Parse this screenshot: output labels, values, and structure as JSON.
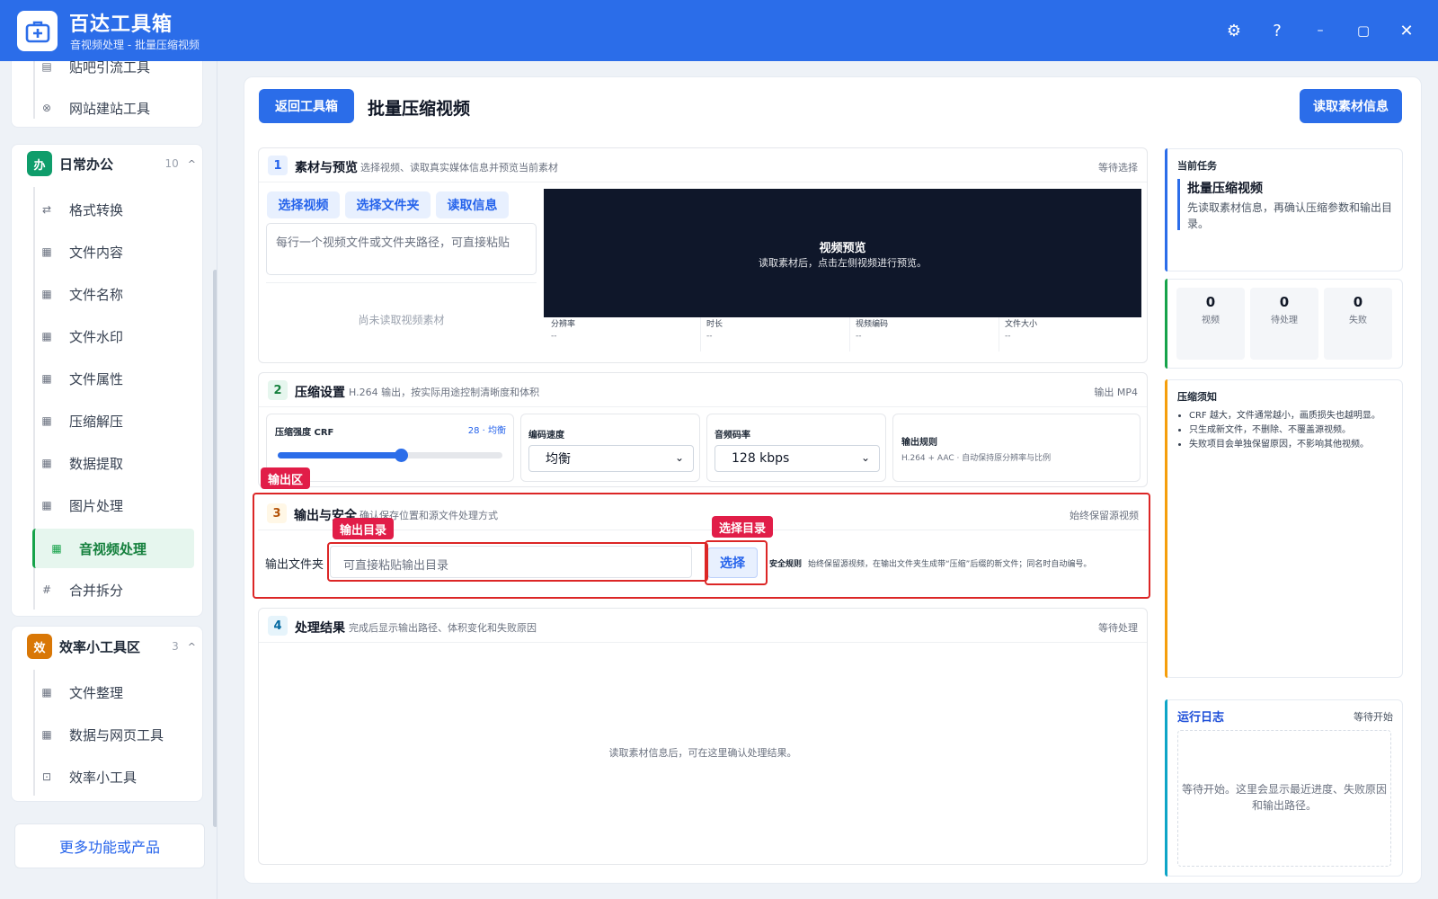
{
  "app": {
    "title": "百达工具箱",
    "subtitle": "音视频处理 - 批量压缩视频"
  },
  "window_controls": {
    "settings": "⚙",
    "help": "?",
    "minimize": "–",
    "maximize": "▢",
    "close": "✕"
  },
  "sidebar": {
    "top_items": [
      {
        "label": "贴吧引流工具",
        "icon": "doc-icon"
      },
      {
        "label": "网站建站工具",
        "icon": "globe-icon"
      }
    ],
    "groups": [
      {
        "title": "日常办公",
        "badge": "办",
        "count": "10",
        "items": [
          {
            "label": "格式转换",
            "icon": "swap-icon"
          },
          {
            "label": "文件内容",
            "icon": "grid-icon"
          },
          {
            "label": "文件名称",
            "icon": "grid-icon"
          },
          {
            "label": "文件水印",
            "icon": "grid-icon"
          },
          {
            "label": "文件属性",
            "icon": "grid-icon"
          },
          {
            "label": "压缩解压",
            "icon": "grid-icon"
          },
          {
            "label": "数据提取",
            "icon": "grid-icon"
          },
          {
            "label": "图片处理",
            "icon": "grid-icon"
          },
          {
            "label": "音视频处理",
            "icon": "grid-icon"
          },
          {
            "label": "合并拆分",
            "icon": "hash-icon"
          }
        ]
      },
      {
        "title": "效率小工具区",
        "badge": "效",
        "count": "3",
        "items": [
          {
            "label": "文件整理",
            "icon": "grid-icon"
          },
          {
            "label": "数据与网页工具",
            "icon": "grid-icon"
          },
          {
            "label": "效率小工具",
            "icon": "box-icon"
          }
        ]
      }
    ],
    "more": "更多功能或产品"
  },
  "header": {
    "back": "返回工具箱",
    "title": "批量压缩视频",
    "read_info": "读取素材信息"
  },
  "section1": {
    "num": "1",
    "title": "素材与预览",
    "desc": "选择视频、读取真实媒体信息并预览当前素材",
    "status": "等待选择",
    "btn_select_video": "选择视频",
    "btn_select_folder": "选择文件夹",
    "btn_read_info": "读取信息",
    "textarea_placeholder": "每行一个视频文件或文件夹路径，可直接粘贴",
    "empty": "尚未读取视频素材",
    "preview_title": "视频预览",
    "preview_desc": "读取素材后，点击左侧视频进行预览。",
    "meta": [
      {
        "label": "分辨率",
        "value": "--"
      },
      {
        "label": "时长",
        "value": "--"
      },
      {
        "label": "视频编码",
        "value": "--"
      },
      {
        "label": "文件大小",
        "value": "--"
      }
    ]
  },
  "section2": {
    "num": "2",
    "title": "压缩设置",
    "desc": "H.264 输出，按实际用途控制清晰度和体积",
    "status": "输出 MP4",
    "crf_label": "压缩强度 CRF",
    "crf_value": "28 · 均衡",
    "crf": 28,
    "speed_label": "编码速度",
    "speed_value": "均衡",
    "audio_label": "音频码率",
    "audio_value": "128 kbps",
    "rule_label": "输出规则",
    "rule_desc": "H.264 + AAC · 自动保持原分辨率与比例"
  },
  "section3": {
    "num": "3",
    "title": "输出与安全",
    "desc": "确认保存位置和源文件处理方式",
    "status": "始终保留源视频",
    "folder_label": "输出文件夹",
    "folder_placeholder": "可直接粘贴输出目录",
    "choose": "选择",
    "safety_label": "安全规则",
    "safety_desc": "始终保留源视频，在输出文件夹生成带“压缩”后缀的新文件；同名时自动编号。"
  },
  "section4": {
    "num": "4",
    "title": "处理结果",
    "desc": "完成后显示输出路径、体积变化和失败原因",
    "status": "等待处理",
    "empty": "读取素材信息后，可在这里确认处理结果。"
  },
  "annotations": {
    "output_area": "输出区",
    "output_dir": "输出目录",
    "choose_dir": "选择目录"
  },
  "right": {
    "task_label": "当前任务",
    "task_title": "批量压缩视频",
    "task_desc": "先读取素材信息，再确认压缩参数和输出目录。",
    "stats": [
      {
        "value": "0",
        "label": "视频"
      },
      {
        "value": "0",
        "label": "待处理"
      },
      {
        "value": "0",
        "label": "失败"
      }
    ],
    "notes_title": "压缩须知",
    "notes": [
      "CRF 越大，文件通常越小，画质损失也越明显。",
      "只生成新文件，不删除、不覆盖源视频。",
      "失败项目会单独保留原因，不影响其他视频。"
    ],
    "log_title": "运行日志",
    "log_status": "等待开始",
    "log_empty": "等待开始。这里会显示最近进度、失败原因和输出路径。"
  },
  "colors": {
    "primary": "#2b6de9",
    "active_green": "#16a34a",
    "annotation_red": "#dc2626"
  }
}
